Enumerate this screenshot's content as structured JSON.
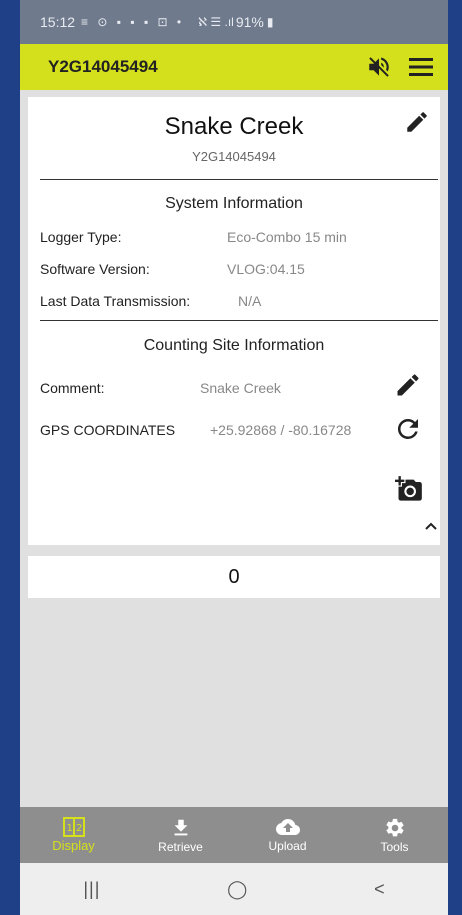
{
  "status_bar": {
    "time": "15:12",
    "notification_icons": "≡ ⊙ ▪ ▪ ▪ ⊡ •",
    "signal_text": "ℵ ☰ .ıl",
    "battery": "91%"
  },
  "app_bar": {
    "device_id": "Y2G14045494",
    "mute_icon": "volume-off-icon",
    "menu_icon": "menu-icon",
    "accent_color": "#d4e01c"
  },
  "site": {
    "name": "Snake Creek",
    "id": "Y2G14045494"
  },
  "system_info": {
    "title": "System Information",
    "rows": [
      {
        "label": "Logger Type:",
        "value": "Eco-Combo 15 min"
      },
      {
        "label": "Software Version:",
        "value": "VLOG:04.15"
      },
      {
        "label": "Last Data Transmission:",
        "value": "N/A"
      }
    ]
  },
  "counting_site": {
    "title": "Counting Site Information",
    "comment_label": "Comment:",
    "comment_value": "Snake Creek",
    "gps_label": "GPS COORDINATES",
    "gps_value": "+25.92868 / -80.16728"
  },
  "counter": {
    "value": "0"
  },
  "bottom_nav": [
    {
      "label": "Display",
      "icon": "display-icon",
      "active": true
    },
    {
      "label": "Retrieve",
      "icon": "download-icon",
      "active": false
    },
    {
      "label": "Upload",
      "icon": "cloud-upload-icon",
      "active": false
    },
    {
      "label": "Tools",
      "icon": "gear-icon",
      "active": false
    }
  ],
  "system_nav": {
    "recents": "|||",
    "home": "◯",
    "back": "<"
  }
}
